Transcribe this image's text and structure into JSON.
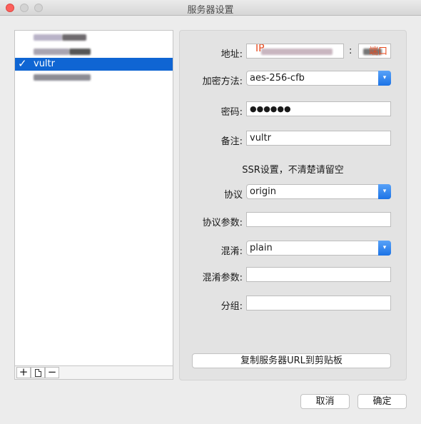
{
  "window": {
    "title": "服务器设置"
  },
  "server_list": {
    "items": [
      {
        "label": "",
        "selected": false
      },
      {
        "label": "",
        "selected": false
      },
      {
        "label": "vultr",
        "selected": true
      },
      {
        "label": "",
        "selected": false
      }
    ]
  },
  "list_toolbar": {
    "add": "+",
    "remove": "−"
  },
  "form": {
    "address_label": "地址:",
    "address_value": "IP",
    "port_colon": ":",
    "port_value": "端口",
    "encryption_label": "加密方法:",
    "encryption_value": "aes-256-cfb",
    "password_label": "密码:",
    "password_value": "●●●●●●",
    "remark_label": "备注:",
    "remark_value": "vultr",
    "ssr_note": "SSR设置，不清楚请留空",
    "protocol_label": "协议",
    "protocol_value": "origin",
    "protocol_param_label": "协议参数:",
    "protocol_param_value": "",
    "obfs_label": "混淆:",
    "obfs_value": "plain",
    "obfs_param_label": "混淆参数:",
    "obfs_param_value": "",
    "group_label": "分组:",
    "group_value": ""
  },
  "actions": {
    "copy_url": "复制服务器URL到剪贴板",
    "cancel": "取消",
    "ok": "确定"
  },
  "colors": {
    "selection": "#0f65d3",
    "accent": "#1c73e6",
    "annotation": "#e8491d"
  }
}
